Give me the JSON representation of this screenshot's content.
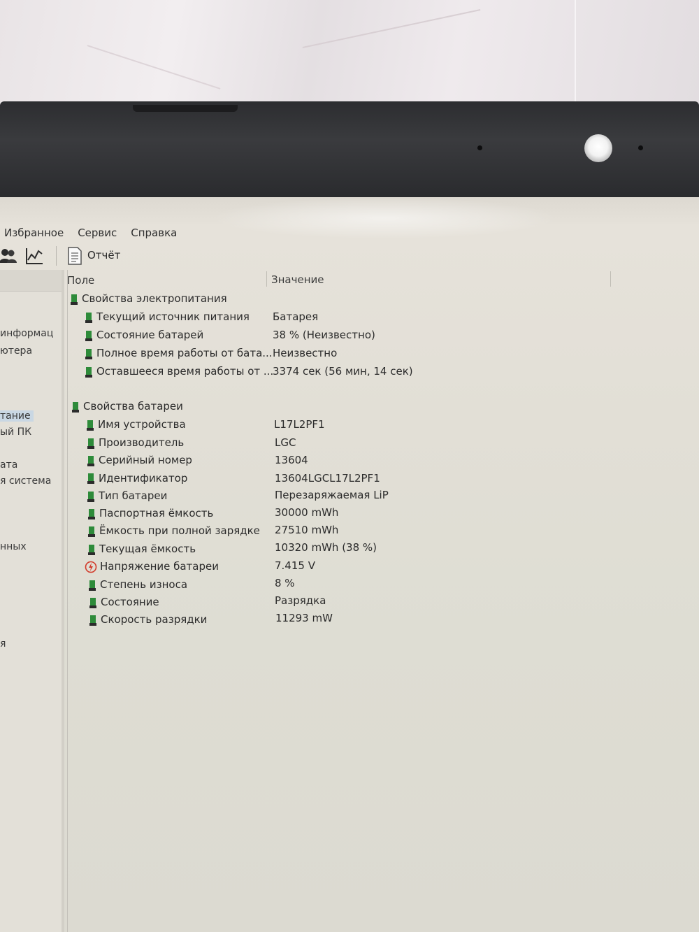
{
  "menu": {
    "favorites": "Избранное",
    "service": "Сервис",
    "help": "Справка"
  },
  "toolbar": {
    "report_label": "Отчёт",
    "icons": [
      "users-icon",
      "chart-icon",
      "report-icon"
    ]
  },
  "left_pane": {
    "items": [
      {
        "label": "информац"
      },
      {
        "label": "ютера"
      },
      {
        "label": "тание",
        "selected": true
      },
      {
        "label": "ый ПК"
      },
      {
        "label": "ата"
      },
      {
        "label": "я система"
      },
      {
        "label": "нных"
      },
      {
        "label": "я"
      }
    ]
  },
  "table": {
    "col_field": "Поле",
    "col_value": "Значение",
    "groups": [
      {
        "title": "Свойства электропитания",
        "rows": [
          {
            "field": "Текущий источник питания",
            "value": "Батарея"
          },
          {
            "field": "Состояние батарей",
            "value": "38 % (Неизвестно)"
          },
          {
            "field": "Полное время работы от бата...",
            "value": "Неизвестно"
          },
          {
            "field": "Оставшееся время работы от ...",
            "value": "3374 сек (56 мин, 14 сек)"
          }
        ]
      },
      {
        "title": "Свойства батареи",
        "rows": [
          {
            "field": "Имя устройства",
            "value": "L17L2PF1"
          },
          {
            "field": "Производитель",
            "value": "LGC"
          },
          {
            "field": "Серийный номер",
            "value": "13604"
          },
          {
            "field": "Идентификатор",
            "value": "13604LGCL17L2PF1"
          },
          {
            "field": "Тип батареи",
            "value": "Перезаряжаемая LiP"
          },
          {
            "field": "Паспортная ёмкость",
            "value": "30000 mWh"
          },
          {
            "field": "Ёмкость при полной зарядке",
            "value": "27510 mWh"
          },
          {
            "field": "Текущая ёмкость",
            "value": "10320 mWh  (38 %)"
          },
          {
            "field": "Напряжение батареи",
            "value": "7.415 V"
          },
          {
            "field": "Степень износа",
            "value": "8 %"
          },
          {
            "field": "Состояние",
            "value": "Разрядка"
          },
          {
            "field": "Скорость разрядки",
            "value": "11293 mW"
          }
        ]
      }
    ]
  },
  "colors": {
    "battery_green": "#2e8b3a",
    "battery_dark": "#2b2b2b",
    "voltage_red": "#d23a2a",
    "selection": "#c9d7e3"
  }
}
